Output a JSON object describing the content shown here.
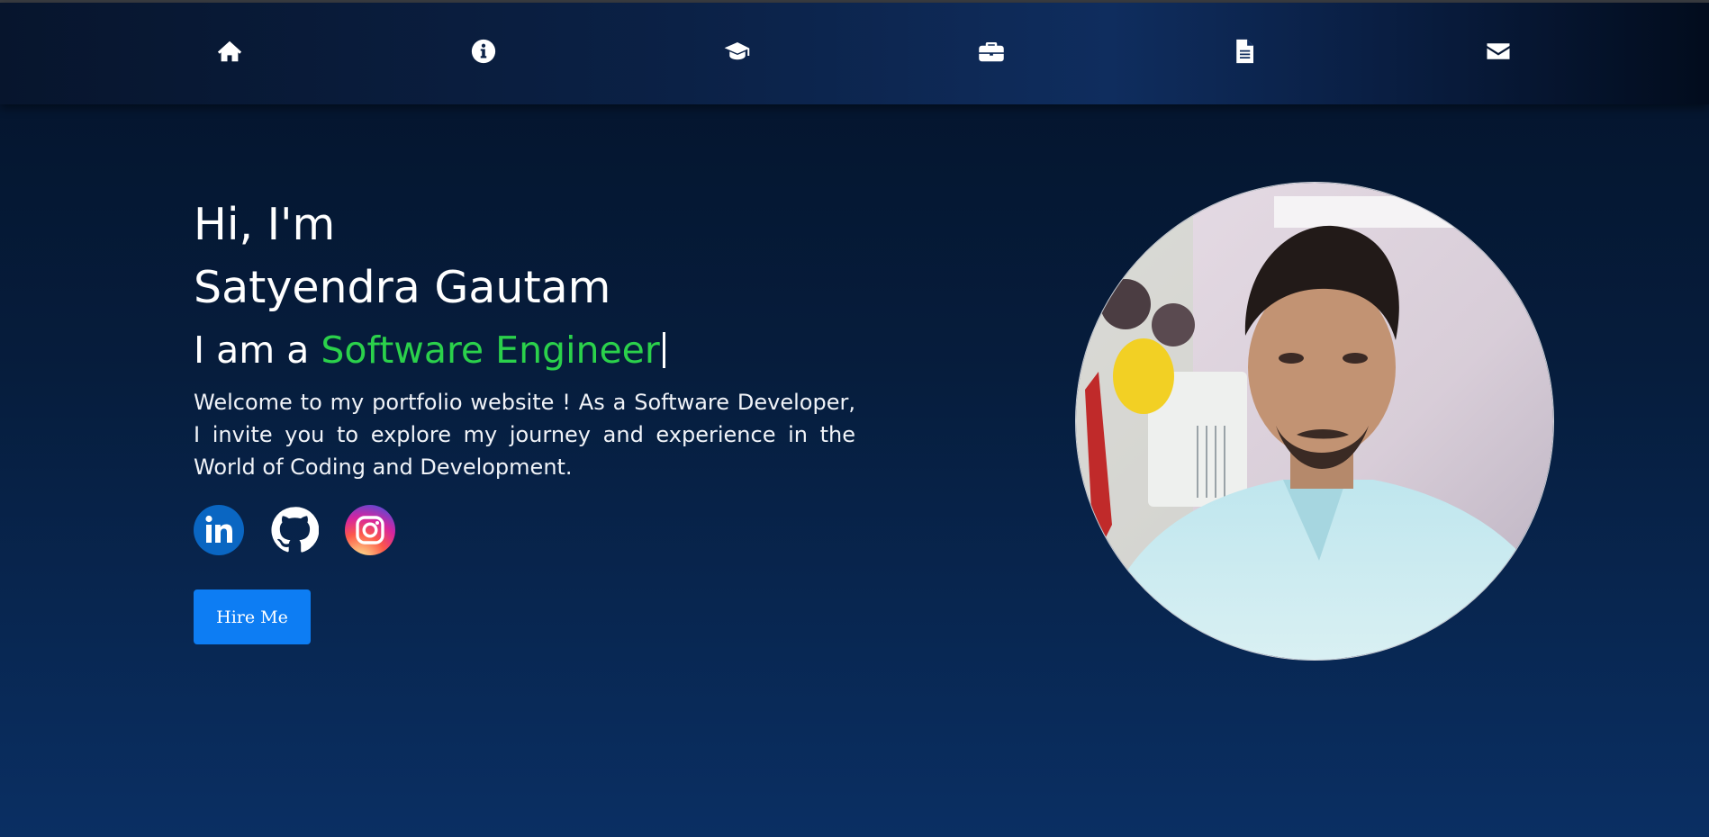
{
  "nav": {
    "items": [
      {
        "name": "home-icon"
      },
      {
        "name": "info-icon"
      },
      {
        "name": "graduation-cap-icon"
      },
      {
        "name": "briefcase-icon"
      },
      {
        "name": "document-icon"
      },
      {
        "name": "envelope-icon"
      }
    ]
  },
  "hero": {
    "greeting": "Hi, I'm",
    "name": "Satyendra Gautam",
    "role_prefix": "I am a ",
    "role_highlight": "Software Engineer",
    "intro": "Welcome to my portfolio website ! As a Software Developer, I invite you to explore my journey and experience in the World of Coding and Development.",
    "socials": [
      {
        "icon": "linkedin-icon"
      },
      {
        "icon": "github-icon"
      },
      {
        "icon": "instagram-icon"
      }
    ],
    "hire_label": "Hire Me"
  },
  "colors": {
    "accent": "#2bd14b",
    "button": "#0d7df3",
    "background_top": "#04132a",
    "background_bottom": "#0a2f63"
  }
}
